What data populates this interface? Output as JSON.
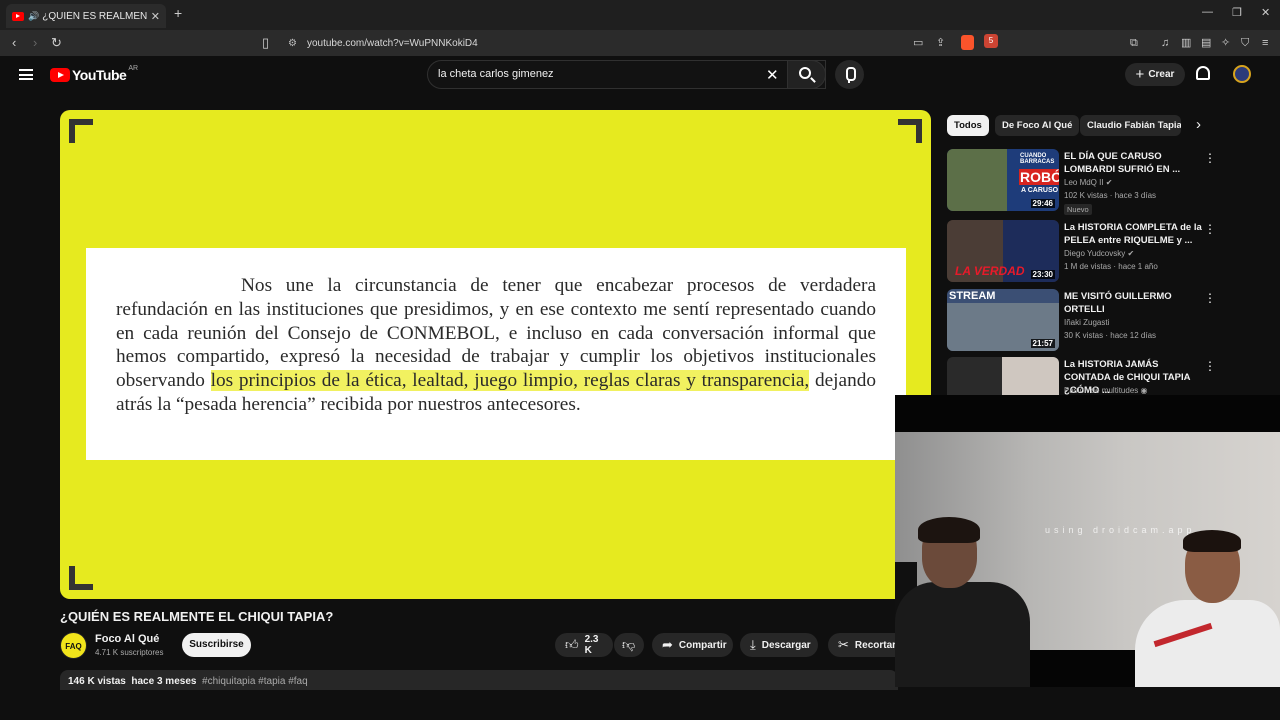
{
  "browser": {
    "tab_title": "¿QUIÉN ES REALMENTE EL CHIQUI",
    "tab_close": "✕",
    "new_tab": "+",
    "url": "youtube.com/watch?v=WuPNNKokiD4",
    "notification_count": "5"
  },
  "youtube": {
    "logo_text": "YouTube",
    "country_code": "AR",
    "search_query": "la cheta carlos gimenez",
    "create_label": "Crear"
  },
  "video": {
    "document_lines": {
      "p1": "Nos une la circunstancia de tener que encabezar procesos de verdadera refundación en las instituciones que presidimos, y en ese contexto me sentí representado cuando en cada reunión del Consejo de CONMEBOL, e incluso en cada conversación informal que hemos compartido, expresó la necesidad de trabajar y cumplir los objetivos institucionales observando ",
      "highlight": "los principios de la ética, lealtad, juego limpio, reglas claras y transparencia,",
      "p2": " dejando atrás la “pesada herencia” recibida por nuestros antecesores."
    },
    "title": "¿QUIÉN ES REALMENTE EL CHIQUI TAPIA?",
    "channel": {
      "icon_text": "FAQ",
      "name": "Foco Al Qué",
      "subscribers": "4.71 K suscriptores",
      "subscribe_label": "Suscribirse"
    },
    "actions": {
      "likes": "2.3 K",
      "share": "Compartir",
      "download": "Descargar",
      "clip": "Recortar"
    },
    "description": {
      "views": "146 K vistas",
      "date": "hace 3 meses",
      "tags": "#chiquitapia #tapia #faq"
    }
  },
  "chips": [
    "Todos",
    "De Foco Al Qué",
    "Claudio Fabián Tapia"
  ],
  "recommendations": [
    {
      "title": "EL DÍA QUE CARUSO LOMBARDI SUFRIÓ EN ...",
      "channel": "Leo MdQ II ✔",
      "meta": "102 K vistas · hace 3 días",
      "badge": "Nuevo",
      "duration": "29:46",
      "thumb_text": "ROBÓ",
      "thumb_sub": "CUANDO BARRACAS",
      "thumb_small": "A CARUSO",
      "thumb_color": "#1e3c7a"
    },
    {
      "title": "La HISTORIA COMPLETA de la PELEA entre RIQUELME y ...",
      "channel": "Diego Yudcovsky ✔",
      "meta": "1 M de vistas · hace 1 año",
      "badge": "",
      "duration": "23:30",
      "thumb_text": "LA VERDAD",
      "thumb_color": "#3b2a20"
    },
    {
      "title": "ME VISITÓ GUILLERMO ORTELLI",
      "channel": "Iñaki Zugasti",
      "meta": "30 K vistas · hace 12 días",
      "badge": "",
      "duration": "21:57",
      "thumb_text": "STREAM",
      "thumb_color": "#3b4f74"
    },
    {
      "title": "La HISTORIA JAMÁS CONTADA de CHIQUI TAPIA ¿CÓMO ...",
      "channel": "Pasión de multitudes ◉",
      "meta": "",
      "badge": "",
      "duration": "",
      "thumb_text": "",
      "thumb_color": "#2a2a2a"
    }
  ],
  "webcam": {
    "watermark": "using droidcam.app"
  },
  "colors": {
    "video_bg": "#e6ea1f",
    "highlight": "#f1f160",
    "youtube_red": "#ff0000"
  }
}
